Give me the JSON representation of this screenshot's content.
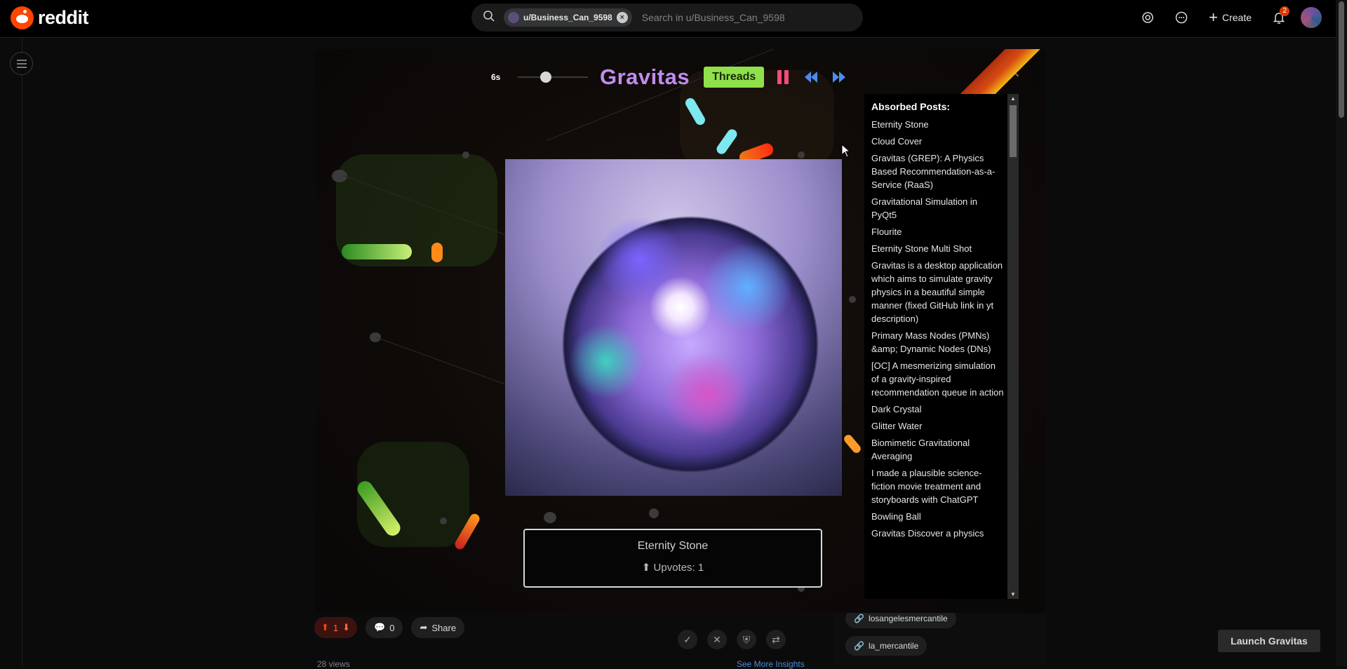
{
  "header": {
    "logo_text": "reddit",
    "search": {
      "chip_label": "u/Business_Can_9598",
      "placeholder": "Search in u/Business_Can_9598"
    },
    "create_label": "Create",
    "notification_count": "2"
  },
  "feed": {
    "vote_count": "1",
    "comment_count": "0",
    "share_label": "Share",
    "views_text": "28 views",
    "see_more_text": "See More Insights"
  },
  "sidebar": {
    "tags": [
      "losangelesmercantile",
      "la_mercantile"
    ]
  },
  "launch_button_label": "Launch Gravitas",
  "gravitas": {
    "timer": "6s",
    "title": "Gravitas",
    "threads_label": "Threads",
    "current_post": {
      "title": "Eternity Stone",
      "upvotes_text": "Upvotes: 1"
    },
    "absorbed": {
      "heading": "Absorbed Posts:",
      "posts": [
        "Eternity Stone",
        "Cloud Cover",
        "Gravitas (GREP): A Physics Based Recommendation-as-a-Service (RaaS)",
        "Gravitational Simulation in PyQt5",
        "Flourite",
        "Eternity Stone Multi Shot",
        "Gravitas is a desktop application which aims to simulate gravity physics in a beautiful simple manner (fixed GitHub link in yt description)",
        "Primary Mass Nodes (PMNs) &amp; Dynamic Nodes (DNs)",
        "[OC] A mesmerizing simulation of a gravity-inspired recommendation queue in action",
        "Dark Crystal",
        "Glitter Water",
        "Biomimetic Gravitational Averaging",
        "I made a plausible science-fiction movie treatment and storyboards with ChatGPT",
        "Bowling Ball",
        "Gravitas Discover a physics"
      ]
    },
    "colors": {
      "title": "#c08cf0",
      "threads_button": "#8fe04a",
      "pause": "#f24c7a",
      "nav_arrows": "#4a8cf0"
    }
  }
}
